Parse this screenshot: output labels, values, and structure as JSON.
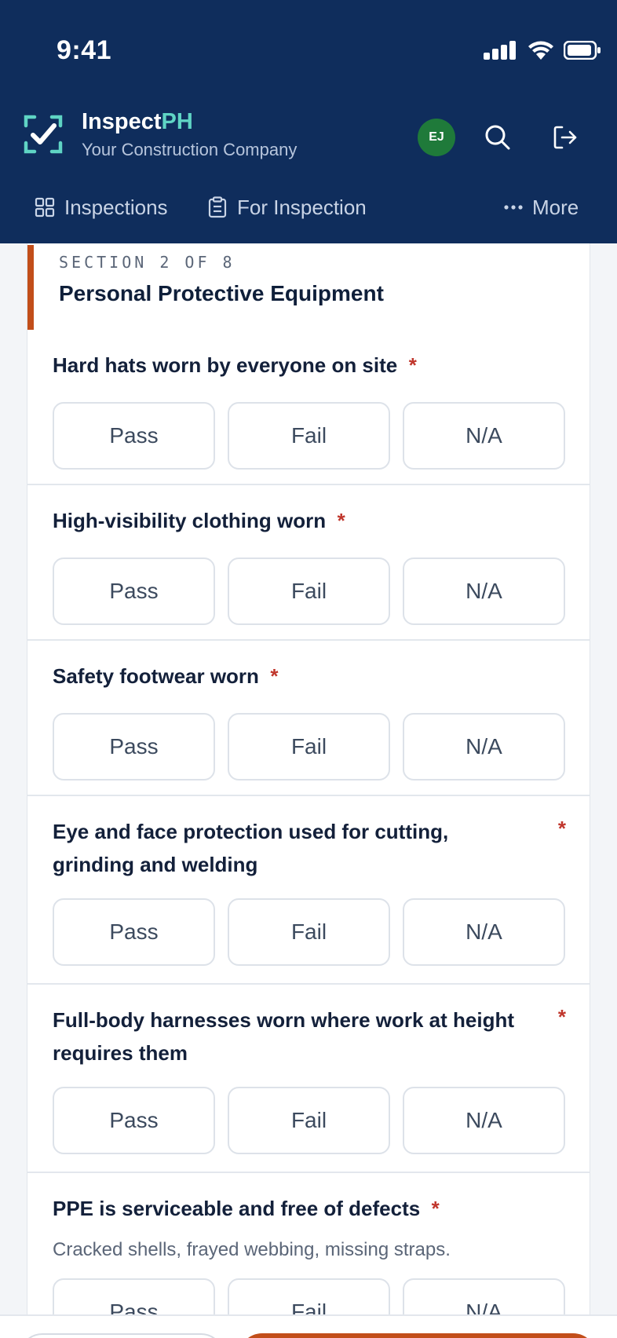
{
  "status": {
    "time": "9:41"
  },
  "header": {
    "brand_main": "Inspect",
    "brand_accent": "PH",
    "company": "Your Construction Company",
    "avatar_initials": "EJ"
  },
  "nav": {
    "inspections": "Inspections",
    "for_inspection": "For Inspection",
    "more": "More"
  },
  "section": {
    "label": "SECTION 2 OF 8",
    "title": "Personal Protective Equipment"
  },
  "options": {
    "pass": "Pass",
    "fail": "Fail",
    "na": "N/A"
  },
  "required_mark": "*",
  "items": [
    {
      "question": "Hard hats worn by everyone on site"
    },
    {
      "question": "High-visibility clothing worn"
    },
    {
      "question": "Safety footwear worn"
    },
    {
      "question": "Eye and face protection used for cutting, grinding and welding"
    },
    {
      "question": "Full-body harnesses worn where work at height requires them"
    },
    {
      "question": "PPE is serviceable and free of defects",
      "hint": "Cracked shells, frayed webbing, missing straps."
    }
  ],
  "colors": {
    "header_bg": "#0f2d5c",
    "brand_accent": "#5fd4c4",
    "avatar_bg": "#1f7a3a",
    "section_accent": "#c24e1a",
    "required": "#c0362c"
  }
}
